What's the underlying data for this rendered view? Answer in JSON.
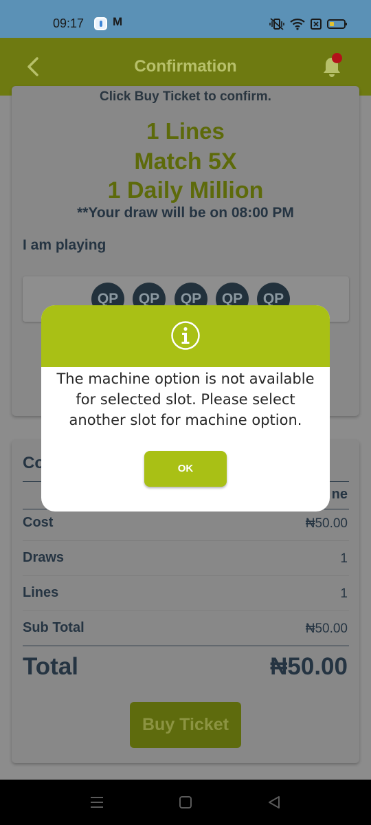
{
  "status_bar": {
    "time": "09:17",
    "mail_glyph": "M",
    "icons": [
      "app-notification-icon",
      "mail-icon",
      "vibrate-icon",
      "wifi-icon",
      "sim-icon",
      "battery-icon"
    ]
  },
  "header": {
    "title": "Confirmation",
    "back_icon": "chevron-left-icon",
    "bell_icon": "bell-icon"
  },
  "ticket": {
    "instruction": "Click Buy Ticket to confirm.",
    "lines_text": "1 Lines",
    "game_text": "Match 5X",
    "draws_text": "1  Daily Million",
    "draw_time_text": "**Your draw will be on 08:00 PM",
    "playing_label": "I am playing",
    "numbers": [
      "QP",
      "QP",
      "QP",
      "QP",
      "QP"
    ]
  },
  "cost": {
    "heading_visible": "Co",
    "column_header_visible": "ne",
    "rows": [
      {
        "label": "Cost",
        "value": "₦50.00"
      },
      {
        "label": "Draws",
        "value": "1"
      },
      {
        "label": "Lines",
        "value": "1"
      },
      {
        "label": "Sub Total",
        "value": "₦50.00"
      }
    ],
    "total_label": "Total",
    "total_value": "₦50.00",
    "buy_label": "Buy Ticket"
  },
  "dialog": {
    "icon": "info-icon",
    "message": "The machine option is not available for selected slot. Please select another slot for machine option.",
    "ok_label": "OK"
  },
  "colors": {
    "accent": "#a9c015",
    "header_dimmed": "#6e7a11",
    "text_dark": "#253442",
    "notification_dot": "#b3121a"
  },
  "nav": {
    "icons": [
      "menu-icon",
      "home-icon",
      "back-triangle-icon"
    ]
  }
}
